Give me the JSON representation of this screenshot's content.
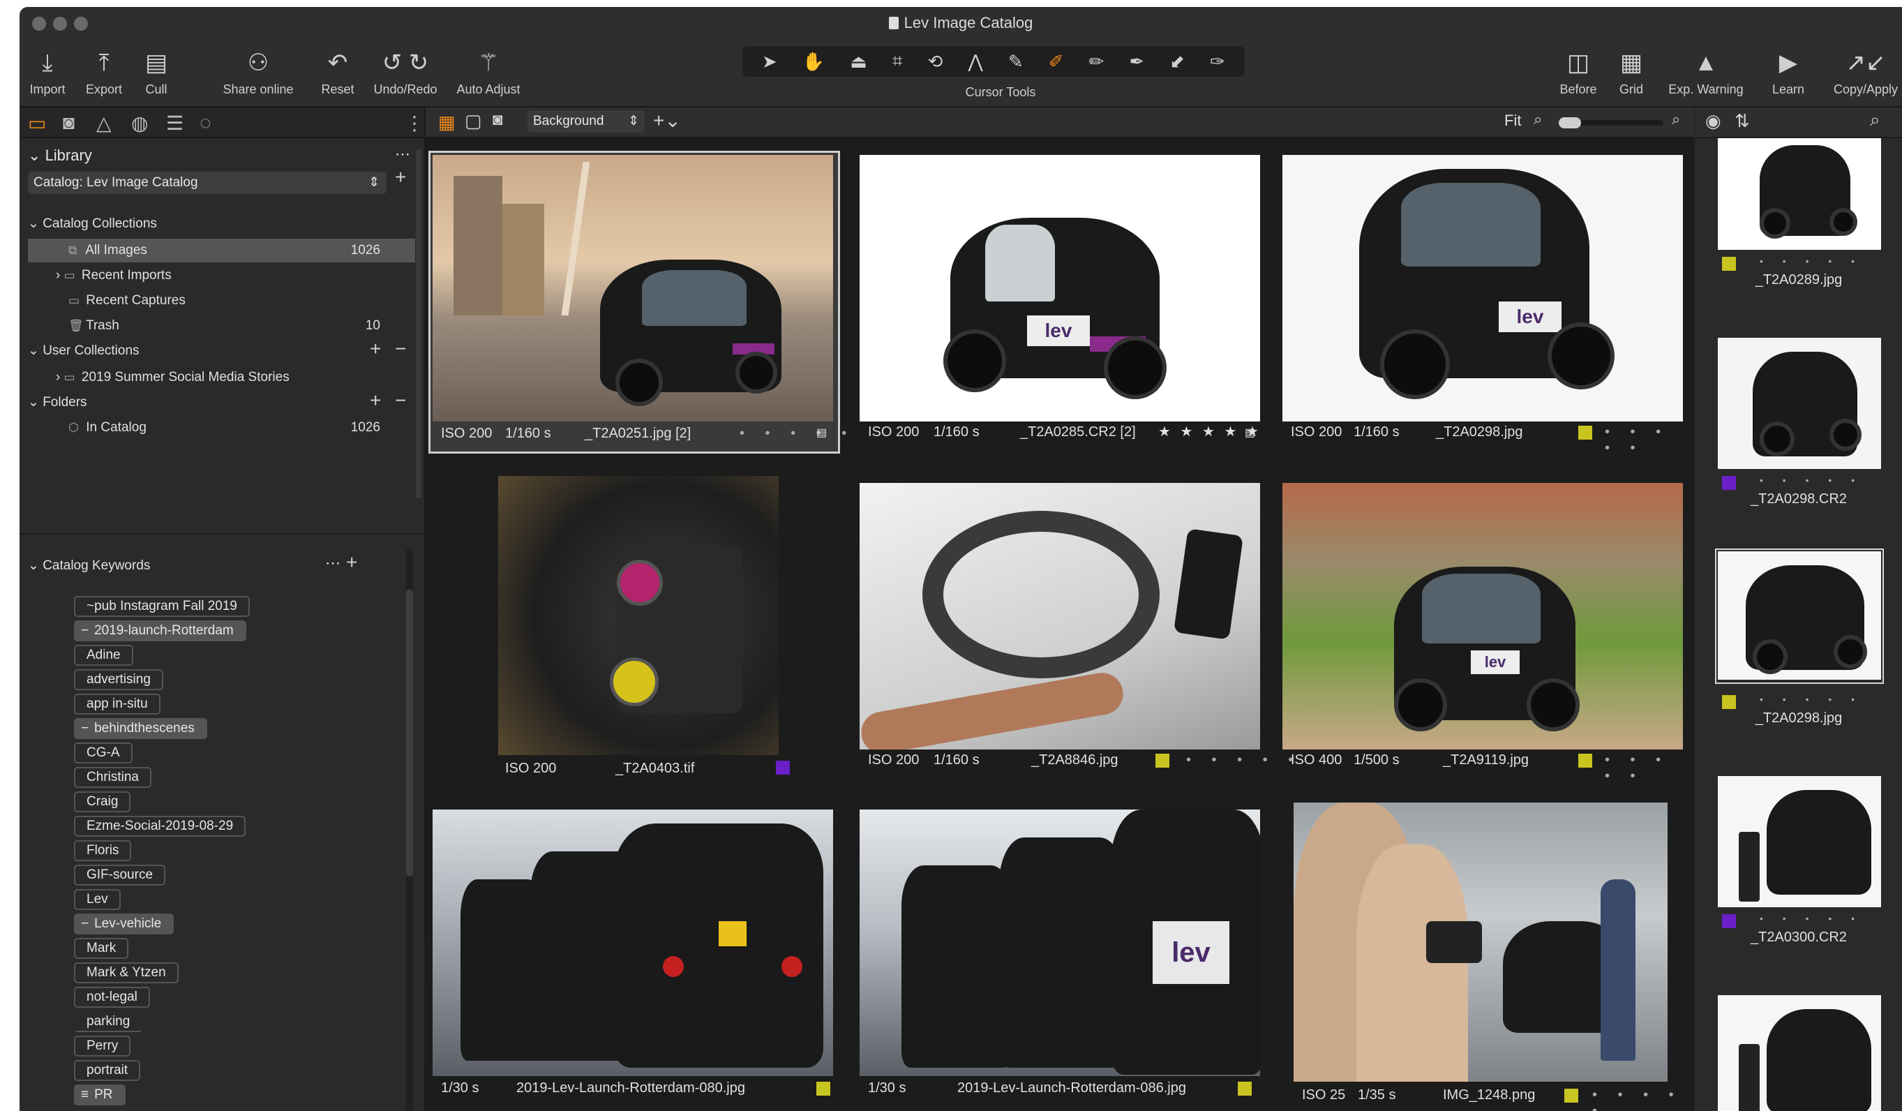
{
  "window": {
    "title": "Lev Image Catalog"
  },
  "toolbar": {
    "import": "Import",
    "export": "Export",
    "cull": "Cull",
    "share": "Share online",
    "reset": "Reset",
    "undo": "Undo/Redo",
    "auto_adjust": "Auto Adjust",
    "cursor_tools": "Cursor Tools",
    "before": "Before",
    "grid": "Grid",
    "exp_warning": "Exp. Warning",
    "learn": "Learn",
    "copy_apply": "Copy/Apply"
  },
  "library": {
    "title": "Library",
    "catalog": "Catalog: Lev Image Catalog",
    "catalog_collections": "Catalog Collections",
    "items": [
      {
        "label": "All Images",
        "count": "1026"
      },
      {
        "label": "Recent Imports",
        "count": ""
      },
      {
        "label": "Recent Captures",
        "count": ""
      },
      {
        "label": "Trash",
        "count": "10"
      }
    ],
    "user_collections": "User Collections",
    "user_items": [
      {
        "label": "2019 Summer Social Media Stories"
      }
    ],
    "folders": "Folders",
    "folder_items": [
      {
        "label": "In Catalog",
        "count": "1026"
      }
    ]
  },
  "keywords": {
    "title": "Catalog Keywords",
    "items": [
      "~pub Instagram Fall 2019",
      "2019-launch-Rotterdam",
      "Adine",
      "advertising",
      "app in-situ",
      "behindthescenes",
      "CG-A",
      "Christina",
      "Craig",
      "Ezme-Social-2019-08-29",
      "Floris",
      "GIF-source",
      "Lev",
      "Lev-vehicle",
      "Mark",
      "Mark & Ytzen",
      "not-legal",
      "parking",
      "Perry",
      "portrait",
      "PR"
    ]
  },
  "browser": {
    "background_select": "Background",
    "fit_label": "Fit",
    "thumbnails": [
      {
        "iso": "ISO 200",
        "shutter": "1/160 s",
        "name": "_T2A0251.jpg [2]",
        "rating": "• • • • •"
      },
      {
        "iso": "ISO 200",
        "shutter": "1/160 s",
        "name": "_T2A0285.CR2 [2]",
        "rating": "★ ★ ★ ★ ★"
      },
      {
        "iso": "ISO 200",
        "shutter": "1/160 s",
        "name": "_T2A0298.jpg",
        "rating": "• • • • •"
      },
      {
        "iso": "ISO 200",
        "shutter": "",
        "name": "_T2A0403.tif",
        "rating": ""
      },
      {
        "iso": "ISO 200",
        "shutter": "1/160 s",
        "name": "_T2A8846.jpg",
        "rating": "• • • • •"
      },
      {
        "iso": "ISO 400",
        "shutter": "1/500 s",
        "name": "_T2A9119.jpg",
        "rating": "• • • • •"
      },
      {
        "iso": "",
        "shutter": "1/30 s",
        "name": "2019-Lev-Launch-Rotterdam-080.jpg",
        "rating": ""
      },
      {
        "iso": "",
        "shutter": "1/30 s",
        "name": "2019-Lev-Launch-Rotterdam-086.jpg",
        "rating": ""
      },
      {
        "iso": "ISO 25",
        "shutter": "1/35 s",
        "name": "IMG_1248.png",
        "rating": "• • • • •"
      }
    ]
  },
  "filmstrip": {
    "items": [
      {
        "name": "_T2A0289.jpg",
        "rating": "• • • • •"
      },
      {
        "name": "_T2A0298.CR2",
        "rating": "• • • • •"
      },
      {
        "name": "_T2A0298.jpg",
        "rating": "• • • • •"
      },
      {
        "name": "_T2A0300.CR2",
        "rating": "• • • • •"
      }
    ]
  },
  "colors": {
    "yellow_tag": "#c8c420",
    "purple_tag": "#6a1fc8",
    "accent": "#f08a1c"
  }
}
